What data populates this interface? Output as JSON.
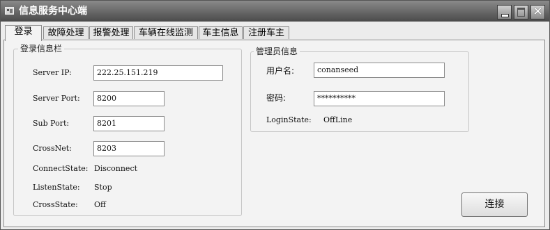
{
  "window": {
    "title": "信息服务中心端"
  },
  "tabs": [
    {
      "label": "登录",
      "active": true
    },
    {
      "label": "故障处理"
    },
    {
      "label": "报警处理"
    },
    {
      "label": "车辆在线监测"
    },
    {
      "label": "车主信息"
    },
    {
      "label": "注册车主"
    }
  ],
  "login_panel": {
    "title": "登录信息栏",
    "server_ip": {
      "label": "Server IP:",
      "value": "222.25.151.219"
    },
    "server_port": {
      "label": "Server Port:",
      "value": "8200"
    },
    "sub_port": {
      "label": "Sub Port:",
      "value": "8201"
    },
    "crossnet": {
      "label": "CrossNet:",
      "value": "8203"
    },
    "connect_state": {
      "label": "ConnectState:",
      "value": "Disconnect"
    },
    "listen_state": {
      "label": "ListenState:",
      "value": "Stop"
    },
    "cross_state": {
      "label": "CrossState:",
      "value": "Off"
    }
  },
  "admin_panel": {
    "title": "管理员信息",
    "username": {
      "label": "用户名:",
      "value": "conanseed"
    },
    "password": {
      "label": "密码:",
      "value": "**********"
    },
    "login_state": {
      "label": "LoginState:",
      "value": "OffLine"
    }
  },
  "actions": {
    "connect_label": "连接"
  }
}
